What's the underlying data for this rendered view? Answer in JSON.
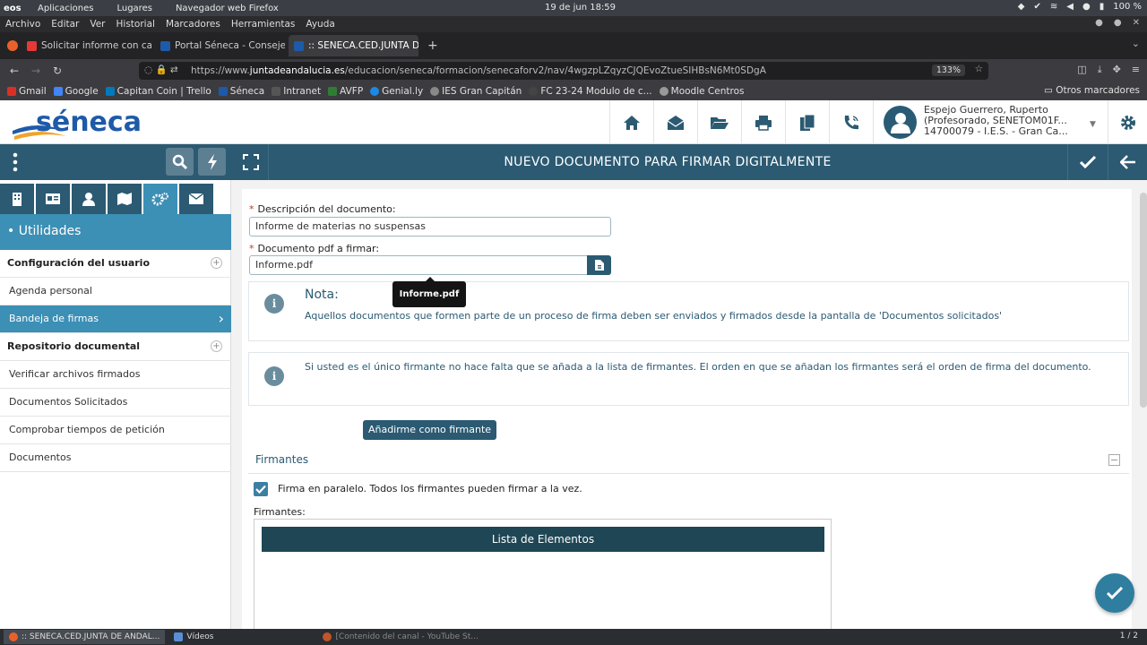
{
  "os": {
    "logo": "eos",
    "menus": [
      "Aplicaciones",
      "Lugares",
      "Navegador web Firefox"
    ],
    "clock": "19 de jun  18:59",
    "battery": "100 %"
  },
  "firefox": {
    "menus": [
      "Archivo",
      "Editar",
      "Ver",
      "Historial",
      "Marcadores",
      "Herramientas",
      "Ayuda"
    ],
    "tabs": [
      {
        "label": "Solicitar informe con cali",
        "color": "#e53935"
      },
      {
        "label": "Portal Séneca - Consejerí",
        "color": "#1e5aa8"
      },
      {
        "label": ":: SENECA.CED.JUNTA DE",
        "color": "#1e5aa8"
      }
    ],
    "url_prefix": "https://www.",
    "url_host": "juntadeandalucia.es",
    "url_path": "/educacion/seneca/formacion/senecaforv2/nav/4wgzpLZqyzCJQEvoZtueSIHBsN6Mt0SDgA",
    "zoom": "133%",
    "bookmarks": [
      {
        "label": "Gmail",
        "color": "#d93025"
      },
      {
        "label": "Google",
        "color": "#4285f4"
      },
      {
        "label": "Capitan Coin | Trello",
        "color": "#0079bf"
      },
      {
        "label": "Séneca",
        "color": "#1e5aa8"
      },
      {
        "label": "Intranet",
        "color": "#555"
      },
      {
        "label": "AVFP",
        "color": "#2e7d32"
      },
      {
        "label": "Genial.ly",
        "color": "#1e88e5"
      },
      {
        "label": "IES Gran Capitán",
        "color": "#888"
      },
      {
        "label": "FC 23-24 Modulo de c...",
        "color": "#444"
      },
      {
        "label": "Moodle Centros",
        "color": "#999"
      }
    ],
    "other_bookmarks": "Otros marcadores"
  },
  "header": {
    "logo": "séneca",
    "user_line1": "Espejo Guerrero, Ruperto",
    "user_line2": "(Profesorado, SENETOM01F...",
    "user_line3": "14700079 - I.E.S. - Gran Ca..."
  },
  "band": {
    "title": "NUEVO DOCUMENTO PARA FIRMAR DIGITALMENTE"
  },
  "sidebar": {
    "section": "• Utilidades",
    "items": [
      {
        "label": "Configuración del usuario",
        "type": "group"
      },
      {
        "label": "Agenda personal",
        "type": "item"
      },
      {
        "label": "Bandeja de firmas",
        "type": "active"
      },
      {
        "label": "Repositorio documental",
        "type": "group"
      },
      {
        "label": "Verificar archivos firmados",
        "type": "item"
      },
      {
        "label": "Documentos Solicitados",
        "type": "item"
      },
      {
        "label": "Comprobar tiempos de petición",
        "type": "item"
      },
      {
        "label": "Documentos",
        "type": "item"
      }
    ]
  },
  "form": {
    "desc_label": "Descripción del documento:",
    "desc_value": "Informe de materias no suspensas",
    "pdf_label": "Documento pdf a firmar:",
    "pdf_value": "Informe.pdf",
    "tooltip": "Informe.pdf",
    "note_title": "Nota:",
    "note_text": "Aquellos documentos que formen parte de un proceso de firma deben ser enviados y firmados desde la pantalla de 'Documentos solicitados'",
    "info_text": "Si usted es el único firmante no hace falta que se añada a la lista de firmantes. El orden en que se añadan los firmantes será el orden de firma del documento.",
    "add_button": "Añadirme como firmante",
    "section_title": "Firmantes",
    "parallel_label": "Firma en paralelo. Todos los firmantes pueden firmar a la vez.",
    "parallel_checked": true,
    "signers_label": "Firmantes:",
    "list_title": "Lista de Elementos"
  },
  "taskbar": {
    "tasks": [
      ":: SENECA.CED.JUNTA DE ANDAL...",
      "Vídeos",
      "[Contenido del canal - YouTube St..."
    ],
    "page": "1 / 2"
  },
  "colors": {
    "primary": "#2b5a72",
    "accent": "#3c8fb5",
    "list_header": "#1f4655"
  }
}
